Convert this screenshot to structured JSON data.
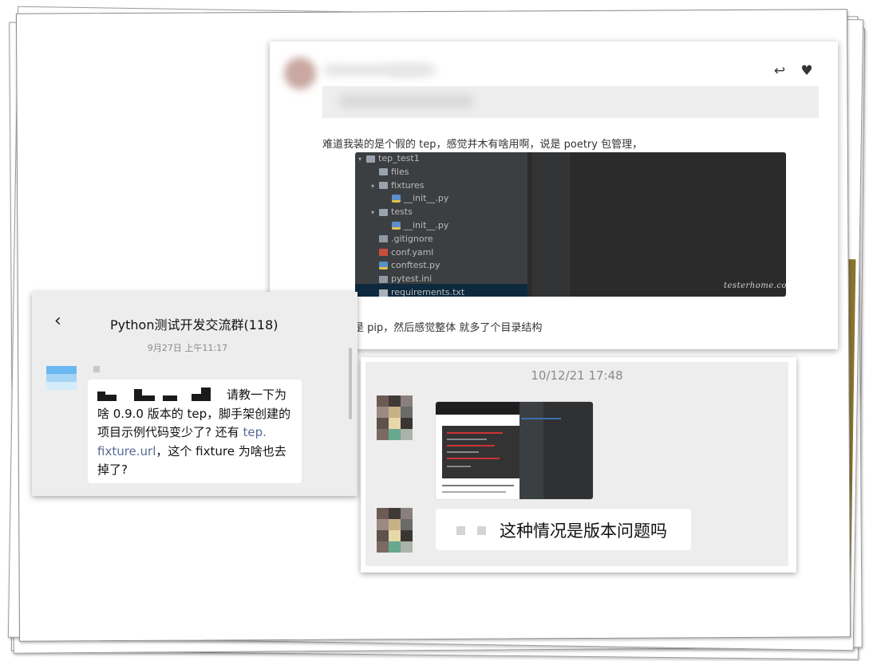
{
  "post": {
    "text1": "难道我装的是个假的 tep，感觉并木有啥用啊，说是 poetry 包管理，",
    "text2": "结果还是 pip，然后感觉整体 就多了个目录结构",
    "reply_icon": "reply-icon",
    "like_icon": "heart-icon"
  },
  "ide": {
    "tree": [
      {
        "label": "tep_test1",
        "icon": "folder",
        "arrow": "▾",
        "indent": 0
      },
      {
        "label": "files",
        "icon": "folder",
        "arrow": "",
        "indent": 1
      },
      {
        "label": "fixtures",
        "icon": "folder",
        "arrow": "▾",
        "indent": 1
      },
      {
        "label": "__init__.py",
        "icon": "py",
        "arrow": "",
        "indent": 2
      },
      {
        "label": "tests",
        "icon": "folder",
        "arrow": "▾",
        "indent": 1
      },
      {
        "label": "__init__.py",
        "icon": "py",
        "arrow": "",
        "indent": 2
      },
      {
        "label": ".gitignore",
        "icon": "file",
        "arrow": "",
        "indent": 1
      },
      {
        "label": "conf.yaml",
        "icon": "yaml",
        "arrow": "",
        "indent": 1
      },
      {
        "label": "conftest.py",
        "icon": "py",
        "arrow": "",
        "indent": 1
      },
      {
        "label": "pytest.ini",
        "icon": "file",
        "arrow": "",
        "indent": 1
      },
      {
        "label": "requirements.txt",
        "icon": "txt",
        "arrow": "",
        "indent": 1
      }
    ],
    "watermark": "testerhome.com"
  },
  "chat_left": {
    "back_icon": "back-chevron-icon",
    "title": "Python测试开发交流群(118)",
    "time": "9月27日 上午11:17",
    "message_a": "请教一下为\n啥 0.9.0 版本的 tep，脚手架创建的\n项目示例代码变少了? 还有 ",
    "message_link": "tep.\nfixture.url",
    "message_b": "，这个 fixture 为啥也去\n掉了?"
  },
  "chat_right": {
    "time": "10/12/21 17:48",
    "message": "这种情况是版本问题吗"
  }
}
